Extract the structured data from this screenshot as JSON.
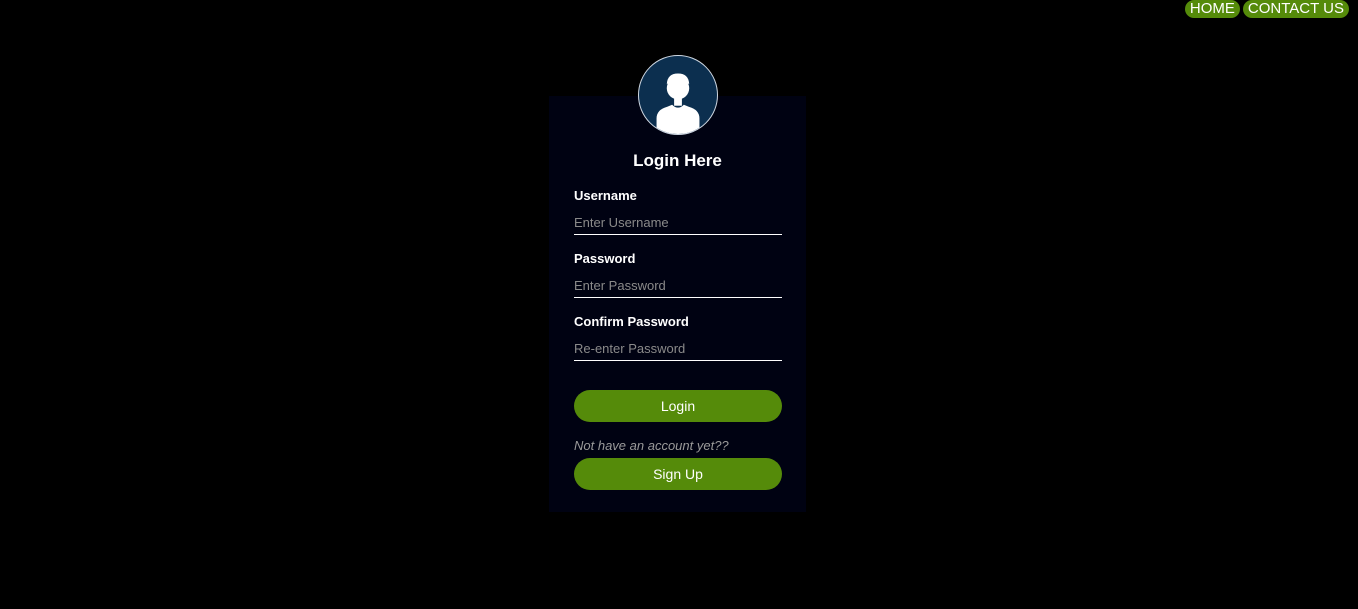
{
  "nav": {
    "items": [
      {
        "label": "HOME"
      },
      {
        "label": "CONTACT US"
      }
    ]
  },
  "login": {
    "avatar_icon": "user-silhouette-icon",
    "title": "Login Here",
    "fields": [
      {
        "label": "Username",
        "placeholder": "Enter Username",
        "value": ""
      },
      {
        "label": "Password",
        "placeholder": "Enter Password",
        "value": ""
      },
      {
        "label": "Confirm Password",
        "placeholder": "Re-enter Password",
        "value": ""
      }
    ],
    "login_label": "Login",
    "signup_hint": "Not have an account yet??",
    "signup_label": "Sign Up"
  },
  "colors": {
    "page_background": "#000000",
    "card_background": "#000212",
    "accent_green": "#558b0a",
    "avatar_background": "#0c2f4f"
  }
}
